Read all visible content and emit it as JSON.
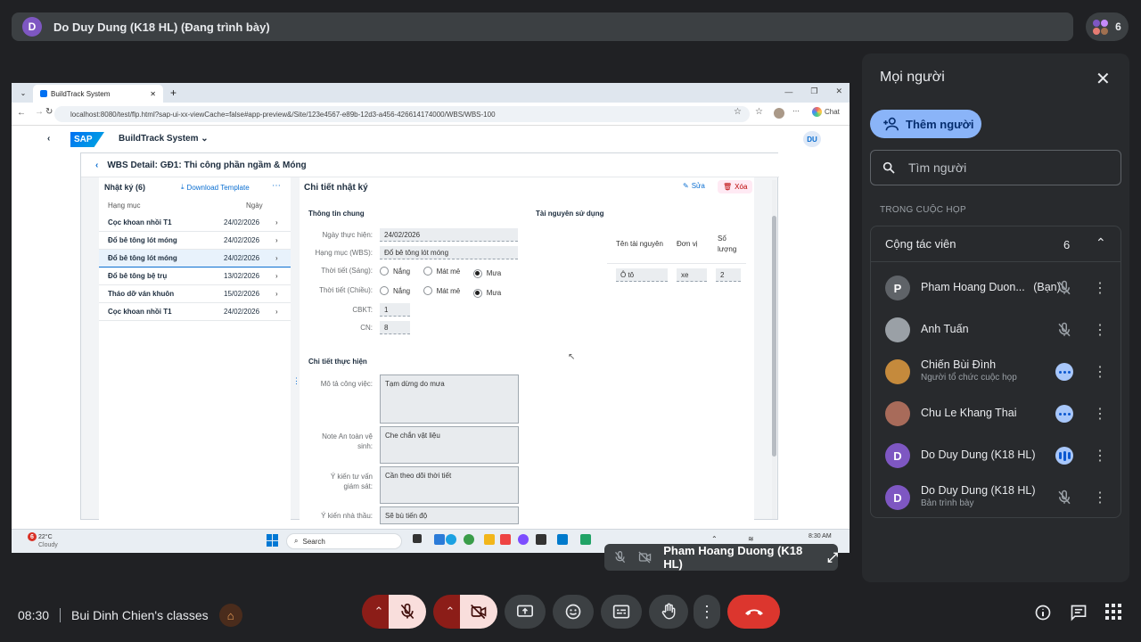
{
  "meet": {
    "presenter_banner": "Do Duy Dung (K18 HL) (Đang trình bày)",
    "presenter_initial": "D",
    "participant_count": "6",
    "presenter_tile": "Pham Hoang Duong (K18 HL)",
    "time": "08:30",
    "meeting_name": "Bui Dinh Chien's classes"
  },
  "browser": {
    "tab_title": "BuildTrack System",
    "url": "localhost:8080/test/flp.html?sap-ui-xx-viewCache=false#app-preview&/Site/123e4567-e89b-12d3-a456-426614174000/WBS/WBS-100",
    "chat_label": "Chat"
  },
  "sap": {
    "logo": "SAP",
    "app_title": "BuildTrack System",
    "user_initials": "DU",
    "page_title": "WBS Detail: GĐ1: Thi công phần ngầm & Móng",
    "left": {
      "title": "Nhật ký (6)",
      "download": "Download Template",
      "col_item": "Hạng mục",
      "col_date": "Ngày",
      "rows": [
        {
          "name": "Cọc khoan nhồi T1",
          "date": "24/02/2026"
        },
        {
          "name": "Đổ bê tông lót móng",
          "date": "24/02/2026"
        },
        {
          "name": "Đổ bê tông lót móng",
          "date": "24/02/2026"
        },
        {
          "name": "Đổ bê tông bệ trụ",
          "date": "13/02/2026"
        },
        {
          "name": "Tháo dỡ ván khuôn",
          "date": "15/02/2026"
        },
        {
          "name": "Cọc khoan nhồi T1",
          "date": "24/02/2026"
        }
      ]
    },
    "detail": {
      "title": "Chi tiết nhật ký",
      "edit": "Sửa",
      "delete": "Xóa",
      "general": "Thông tin chung",
      "date_label": "Ngày thực hiện:",
      "date_value": "24/02/2026",
      "wbs_label": "Hạng mục (WBS):",
      "wbs_value": "Đổ bê tông lót móng",
      "weather_am": "Thời tiết (Sáng):",
      "weather_pm": "Thời tiết (Chiều):",
      "opt_sunny": "Nắng",
      "opt_cool": "Mát mẻ",
      "opt_rain": "Mưa",
      "cbkt_label": "CBKT:",
      "cbkt_value": "1",
      "cn_label": "CN:",
      "cn_value": "8",
      "exec_title": "Chi tiết thực hiện",
      "desc_label": "Mô tả công việc:",
      "desc_value": "Tạm dừng do mưa",
      "safety_label_1": "Note An toàn vệ",
      "safety_label_2": "sinh:",
      "safety_value": "Che chắn vật liệu",
      "consult_label_1": "Ý kiến tư vấn",
      "consult_label_2": "giám sát:",
      "consult_value": "Cần theo dõi thời tiết",
      "contractor_label": "Ý kiến nhà thầu:",
      "contractor_value": "Sẽ bù tiến độ",
      "resources_title": "Tài nguyên sử dụng",
      "res_col_name": "Tên tài nguyên",
      "res_col_unit": "Đơn vị",
      "res_col_qty_1": "Số",
      "res_col_qty_2": "lượng",
      "res_name": "Ô tô",
      "res_unit": "xe",
      "res_qty": "2"
    }
  },
  "taskbar": {
    "temp": "22°C",
    "weather": "Cloudy",
    "badge": "6",
    "search": "Search",
    "clock": "8:30 AM"
  },
  "people": {
    "title": "Mọi người",
    "add": "Thêm người",
    "search_placeholder": "Tìm người",
    "section": "TRONG CUỘC HỌP",
    "group": "Cộng tác viên",
    "group_count": "6",
    "list": [
      {
        "initial": "P",
        "name": "Pham Hoang Duon...",
        "you": "(Bạn)",
        "sub": "",
        "status": "muted"
      },
      {
        "initial": "",
        "name": "Anh Tuấn",
        "sub": "",
        "status": "muted"
      },
      {
        "initial": "",
        "name": "Chiến Bùi Đình",
        "sub": "Người tổ chức cuộc họp",
        "status": "dots"
      },
      {
        "initial": "",
        "name": "Chu Le Khang Thai",
        "sub": "",
        "status": "dots"
      },
      {
        "initial": "D",
        "name": "Do Duy Dung (K18 HL)",
        "sub": "",
        "status": "speaking"
      },
      {
        "initial": "D",
        "name": "Do Duy Dung (K18 HL)",
        "sub": "Bản trình bày",
        "status": "muted"
      }
    ]
  },
  "colors": {
    "accent": "#8ab4f8",
    "leave": "#dc362e",
    "avatar_purple": "#7e57c2"
  }
}
